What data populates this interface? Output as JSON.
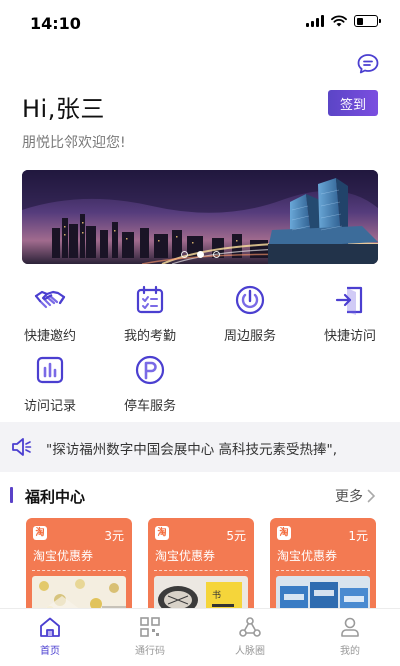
{
  "status_bar": {
    "time": "14:10",
    "battery_level": 0.35
  },
  "header": {
    "greeting": "Hi,张三",
    "checkin_label": "签到",
    "welcome": "朋悦比邻欢迎您!"
  },
  "banner": {
    "slides": 3,
    "active_slide": 2
  },
  "quick_actions": [
    {
      "label": "快捷邀约",
      "icon": "handshake-icon"
    },
    {
      "label": "我的考勤",
      "icon": "calendar-icon"
    },
    {
      "label": "周边服务",
      "icon": "power-target-icon"
    },
    {
      "label": "快捷访问",
      "icon": "enter-door-icon"
    },
    {
      "label": "访问记录",
      "icon": "bar-chart-icon"
    },
    {
      "label": "停车服务",
      "icon": "parking-icon"
    }
  ],
  "notice": {
    "text": "\"探访福州数字中国会展中心 高科技元素受热捧\","
  },
  "welfare": {
    "title": "福利中心",
    "more_label": "更多",
    "coupons": [
      {
        "badge": "淘",
        "price": "3元",
        "title": "淘宝优惠券"
      },
      {
        "badge": "淘",
        "price": "5元",
        "title": "淘宝优惠券"
      },
      {
        "badge": "淘",
        "price": "1元",
        "title": "淘宝优惠券"
      }
    ]
  },
  "tabbar": [
    {
      "label": "首页",
      "icon": "home-icon",
      "active": true
    },
    {
      "label": "通行码",
      "icon": "qr-code-icon",
      "active": false
    },
    {
      "label": "人脉圈",
      "icon": "network-icon",
      "active": false
    },
    {
      "label": "我的",
      "icon": "user-icon",
      "active": false
    }
  ],
  "colors": {
    "accent": "#5a42c8",
    "coupon": "#f37a52",
    "icon": "#4b3fd0"
  }
}
